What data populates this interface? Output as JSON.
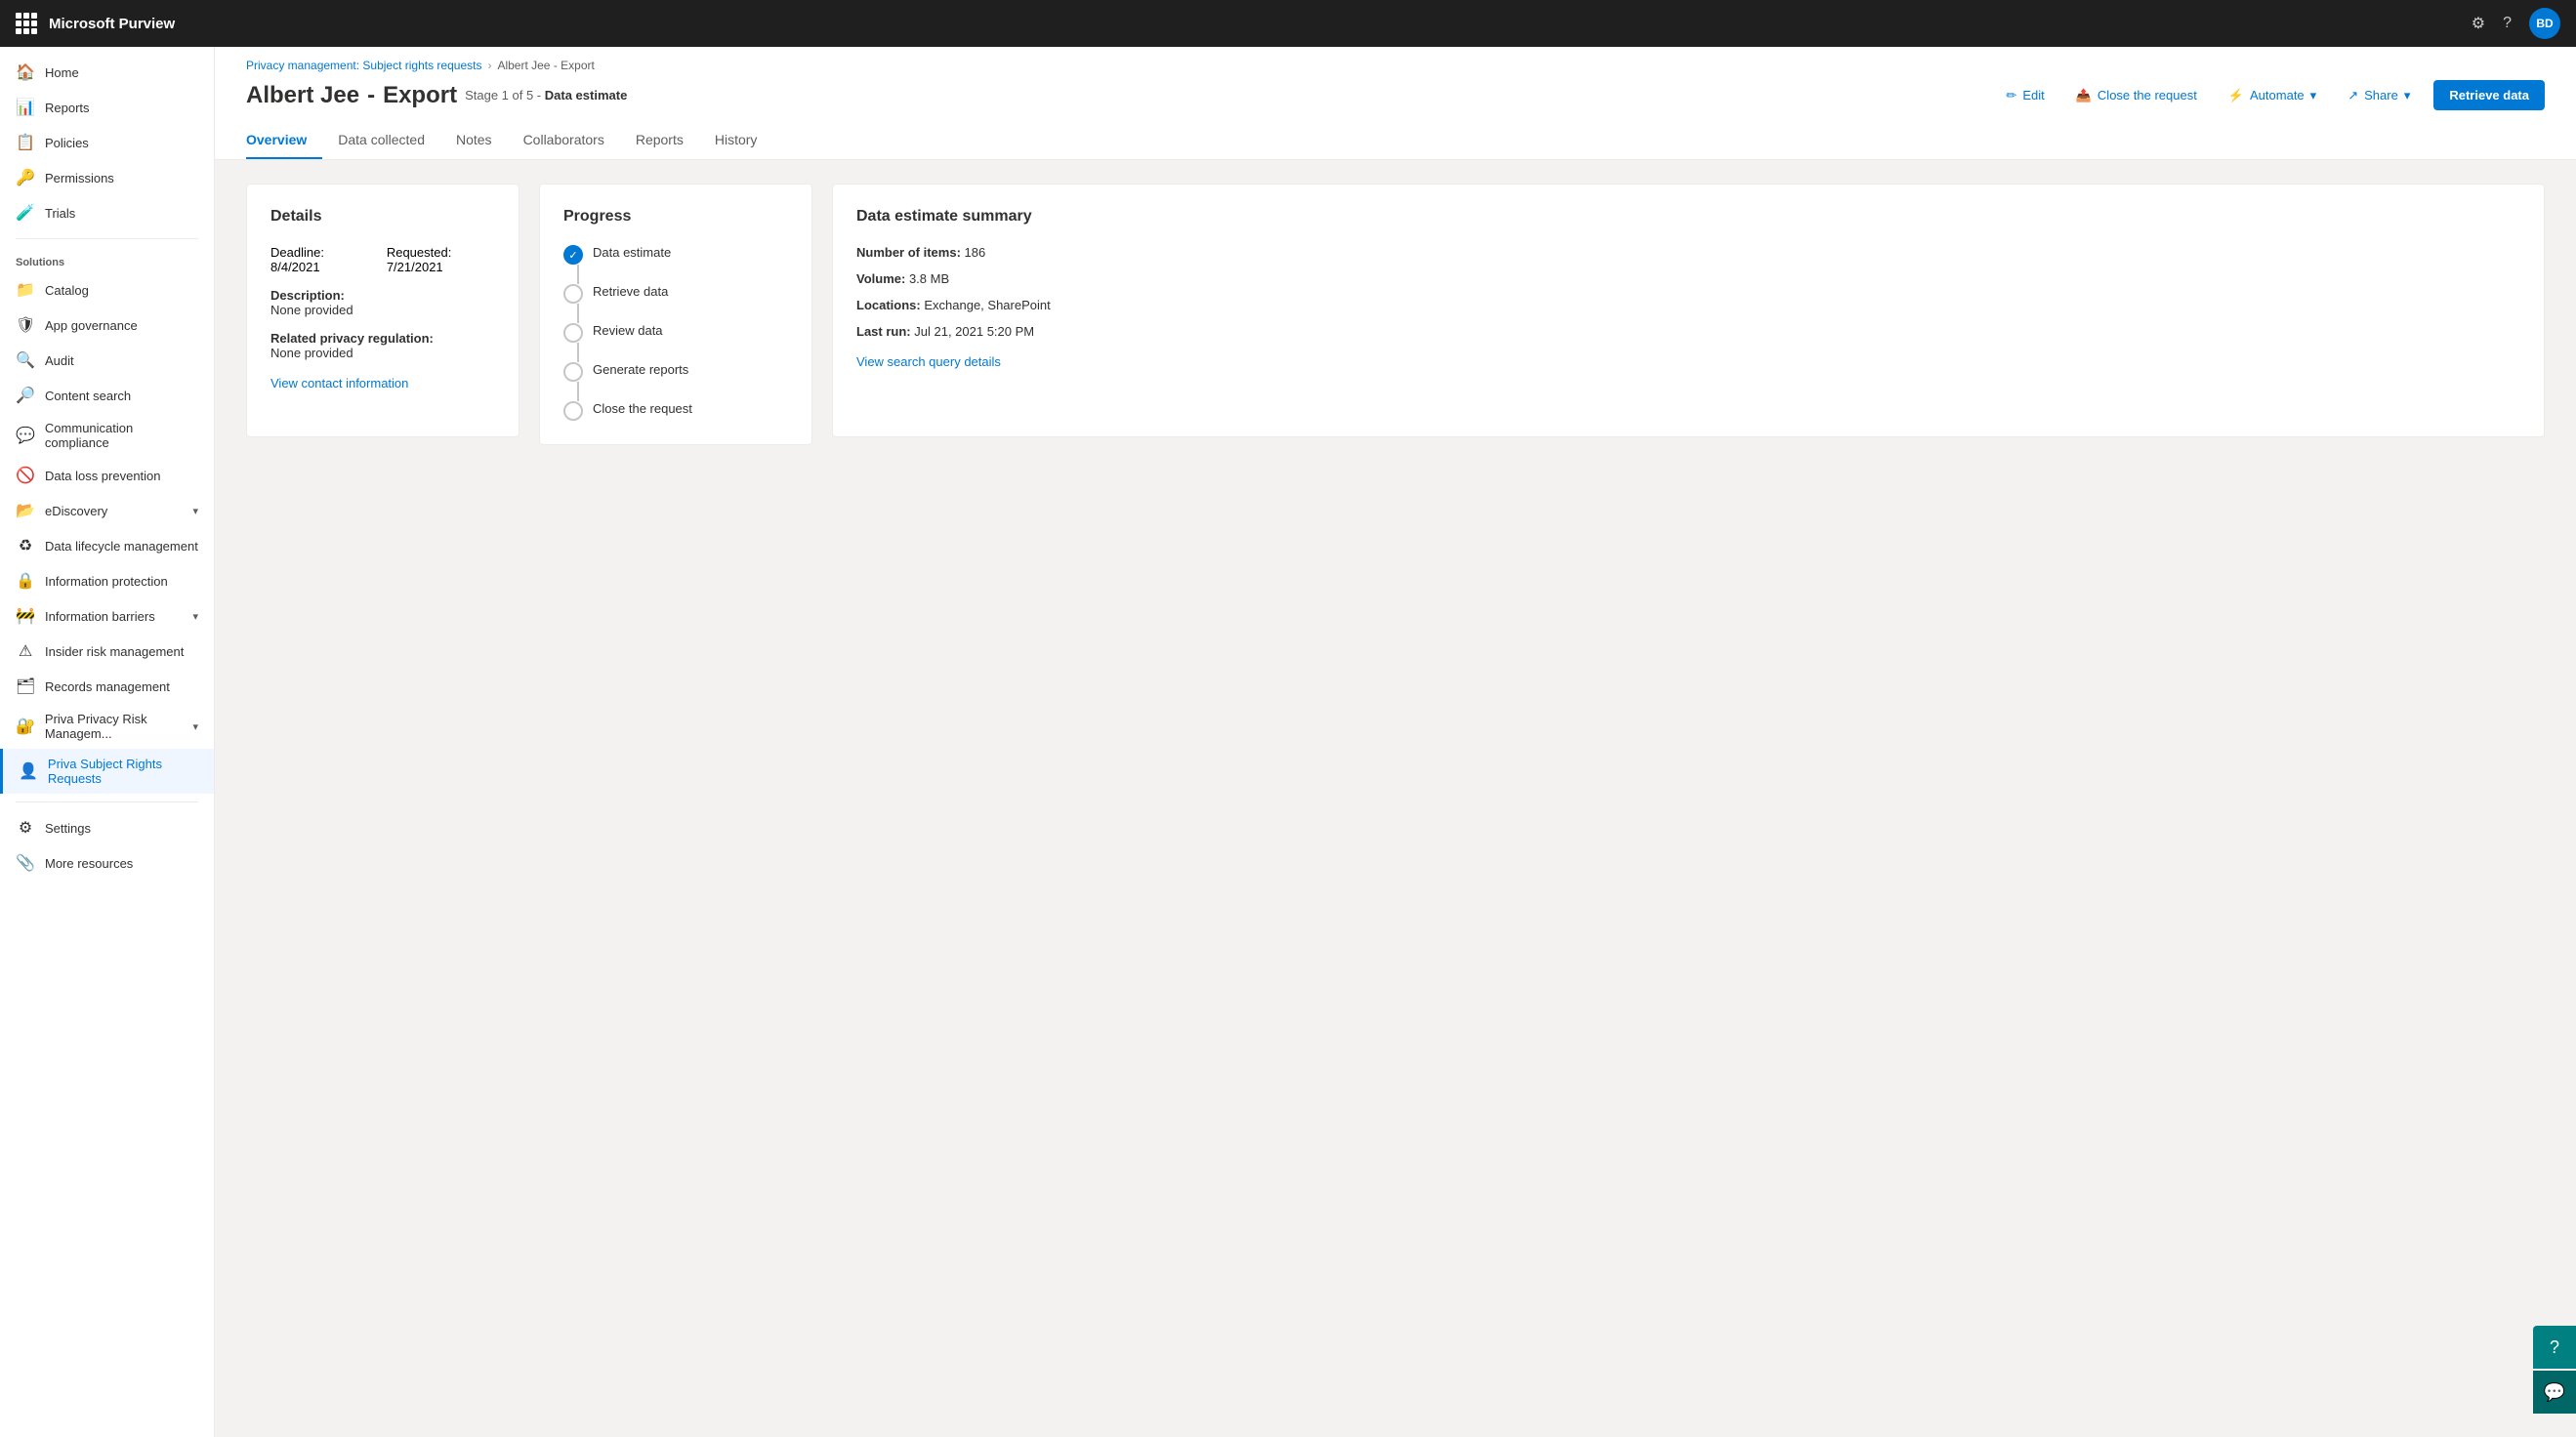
{
  "app": {
    "title": "Microsoft Purview",
    "user_initials": "BD"
  },
  "topbar": {
    "settings_icon": "⚙",
    "help_icon": "?",
    "waffle_tooltip": "Apps"
  },
  "sidebar": {
    "top_items": [
      {
        "id": "home",
        "label": "Home",
        "icon": "🏠"
      },
      {
        "id": "reports",
        "label": "Reports",
        "icon": "📊"
      },
      {
        "id": "policies",
        "label": "Policies",
        "icon": "📋"
      },
      {
        "id": "permissions",
        "label": "Permissions",
        "icon": "🔑"
      },
      {
        "id": "trials",
        "label": "Trials",
        "icon": "🧪"
      }
    ],
    "solutions_header": "Solutions",
    "solution_items": [
      {
        "id": "catalog",
        "label": "Catalog",
        "icon": "📁"
      },
      {
        "id": "app-governance",
        "label": "App governance",
        "icon": "🛡"
      },
      {
        "id": "audit",
        "label": "Audit",
        "icon": "🔍"
      },
      {
        "id": "content-search",
        "label": "Content search",
        "icon": "🔎"
      },
      {
        "id": "communication-compliance",
        "label": "Communication compliance",
        "icon": "💬"
      },
      {
        "id": "data-loss-prevention",
        "label": "Data loss prevention",
        "icon": "🚫"
      },
      {
        "id": "ediscovery",
        "label": "eDiscovery",
        "icon": "📂",
        "has_chevron": true
      },
      {
        "id": "data-lifecycle",
        "label": "Data lifecycle management",
        "icon": "♻"
      },
      {
        "id": "information-protection",
        "label": "Information protection",
        "icon": "🔒"
      },
      {
        "id": "information-barriers",
        "label": "Information barriers",
        "icon": "🚧",
        "has_chevron": true
      },
      {
        "id": "insider-risk",
        "label": "Insider risk management",
        "icon": "⚠"
      },
      {
        "id": "records-management",
        "label": "Records management",
        "icon": "🗂"
      },
      {
        "id": "priva-risk",
        "label": "Priva Privacy Risk Managem...",
        "icon": "🔐",
        "has_chevron": true
      },
      {
        "id": "priva-subject",
        "label": "Priva Subject Rights Requests",
        "icon": "👤",
        "active": true
      }
    ],
    "bottom_items": [
      {
        "id": "settings",
        "label": "Settings",
        "icon": "⚙"
      },
      {
        "id": "more-resources",
        "label": "More resources",
        "icon": "📎"
      }
    ]
  },
  "breadcrumb": {
    "parent": "Privacy management: Subject rights requests",
    "current": "Albert Jee - Export"
  },
  "page": {
    "title_name": "Albert Jee",
    "title_separator": "-",
    "title_type": "Export",
    "stage_text": "Stage 1 of 5 -",
    "stage_highlight": "Data estimate"
  },
  "header_actions": {
    "edit_label": "Edit",
    "close_request_label": "Close the request",
    "automate_label": "Automate",
    "share_label": "Share",
    "retrieve_btn_label": "Retrieve data"
  },
  "tabs": [
    {
      "id": "overview",
      "label": "Overview",
      "active": true
    },
    {
      "id": "data-collected",
      "label": "Data collected"
    },
    {
      "id": "notes",
      "label": "Notes"
    },
    {
      "id": "collaborators",
      "label": "Collaborators"
    },
    {
      "id": "reports",
      "label": "Reports"
    },
    {
      "id": "history",
      "label": "History"
    }
  ],
  "details_card": {
    "title": "Details",
    "deadline_label": "Deadline:",
    "deadline_value": "8/4/2021",
    "requested_label": "Requested:",
    "requested_value": "7/21/2021",
    "description_label": "Description:",
    "description_value": "None provided",
    "regulation_label": "Related privacy regulation:",
    "regulation_value": "None provided",
    "view_link": "View contact information"
  },
  "progress_card": {
    "title": "Progress",
    "steps": [
      {
        "id": "data-estimate",
        "label": "Data estimate",
        "completed": true
      },
      {
        "id": "retrieve-data",
        "label": "Retrieve data",
        "completed": false
      },
      {
        "id": "review-data",
        "label": "Review data",
        "completed": false
      },
      {
        "id": "generate-reports",
        "label": "Generate reports",
        "completed": false
      },
      {
        "id": "close-request",
        "label": "Close the request",
        "completed": false
      }
    ]
  },
  "summary_card": {
    "title": "Data estimate summary",
    "items_label": "Number of items:",
    "items_value": "186",
    "volume_label": "Volume:",
    "volume_value": "3.8 MB",
    "locations_label": "Locations:",
    "locations_value": "Exchange, SharePoint",
    "last_run_label": "Last run:",
    "last_run_value": "Jul 21, 2021 5:20 PM",
    "view_link": "View search query details"
  }
}
